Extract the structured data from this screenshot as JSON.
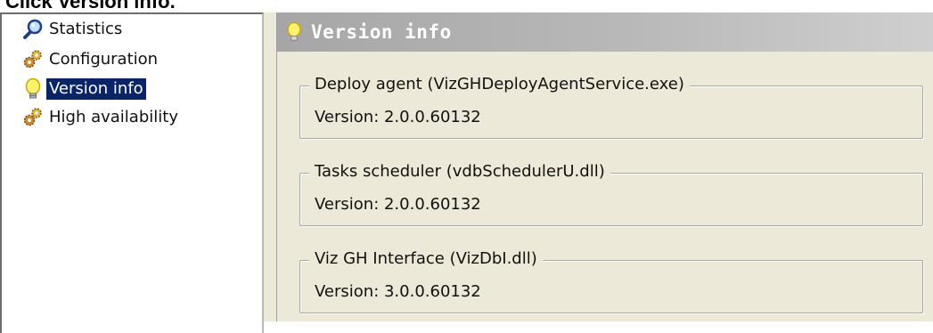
{
  "caption": "Click Version info.",
  "tree": {
    "items": [
      {
        "label": "Statistics",
        "icon": "magnifier-icon"
      },
      {
        "label": "Configuration",
        "icon": "gears-icon"
      },
      {
        "label": "Version info",
        "icon": "lightbulb-icon",
        "selected": true
      },
      {
        "label": "High availability",
        "icon": "gears-icon"
      }
    ]
  },
  "content": {
    "header_title": "Version info",
    "header_icon": "lightbulb-icon",
    "groups": [
      {
        "title": "Deploy agent (VizGHDeployAgentService.exe)",
        "version": "Version: 2.0.0.60132"
      },
      {
        "title": "Tasks scheduler (vdbSchedulerU.dll)",
        "version": "Version: 2.0.0.60132"
      },
      {
        "title": "Viz GH Interface (VizDbI.dll)",
        "version": "Version: 3.0.0.60132"
      }
    ]
  },
  "colors": {
    "selection": "#0a246a",
    "panel_bg": "#ece9d8",
    "header_gradient_start": "#a6a6a6"
  }
}
